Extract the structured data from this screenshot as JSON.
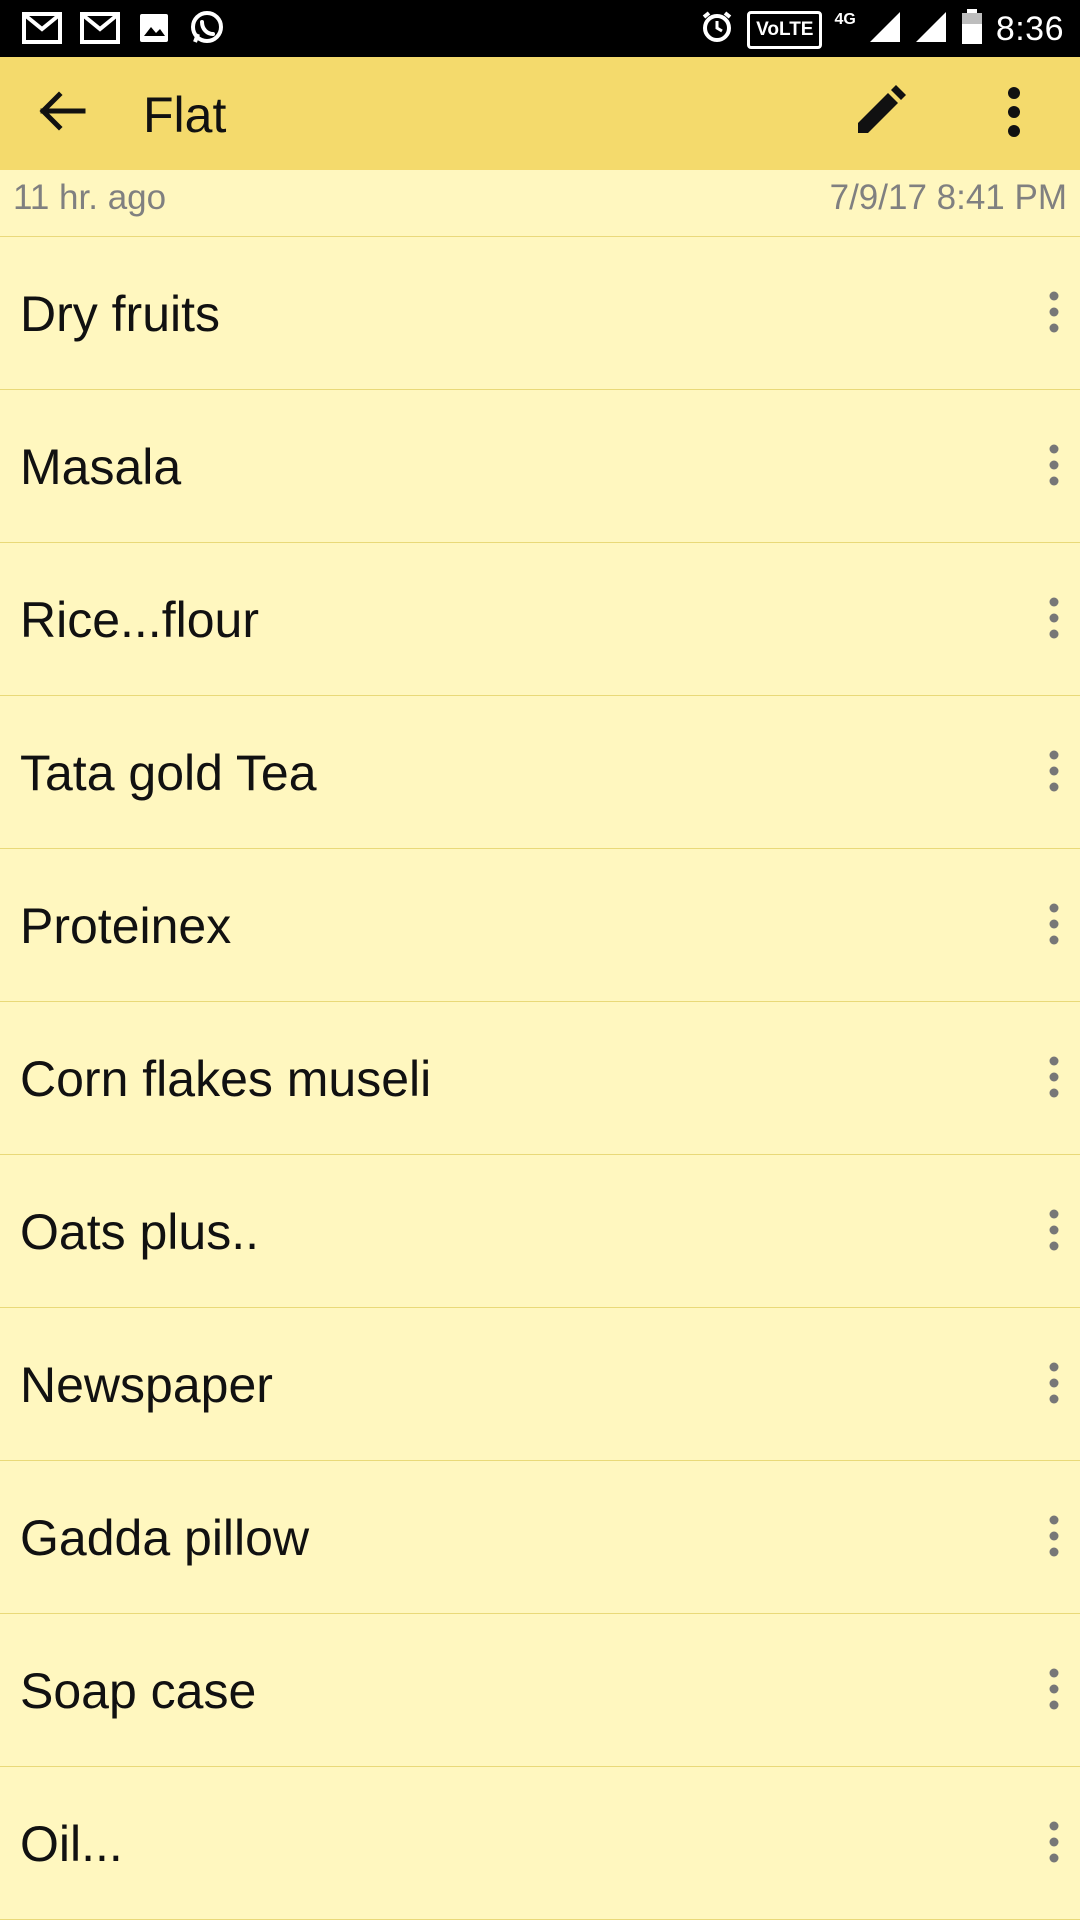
{
  "status_bar": {
    "time": "8:36",
    "volte_label": "VoLTE",
    "network_label": "4G",
    "left_icons": [
      "gmail-icon",
      "gmail-icon",
      "image-icon",
      "whatsapp-icon"
    ],
    "right_icons": [
      "alarm-icon",
      "volte-icon",
      "signal-icon",
      "signal-icon",
      "battery-icon"
    ]
  },
  "app_bar": {
    "title": "Flat",
    "back_icon": "arrow-back-icon",
    "edit_icon": "pencil-icon",
    "more_icon": "more-vert-icon",
    "background": "#f4da6c"
  },
  "meta": {
    "relative_time": "11 hr. ago",
    "date_time": "7/9/17 8:41 PM"
  },
  "items": [
    {
      "label": "Dry fruits"
    },
    {
      "label": "Masala"
    },
    {
      "label": "Rice...flour"
    },
    {
      "label": "Tata gold Tea"
    },
    {
      "label": "Proteinex"
    },
    {
      "label": "Corn flakes museli"
    },
    {
      "label": "Oats plus.."
    },
    {
      "label": "Newspaper"
    },
    {
      "label": "Gadda pillow"
    },
    {
      "label": "Soap case"
    },
    {
      "label": "Oil..."
    }
  ],
  "colors": {
    "list_background": "#fff7bf",
    "divider": "#e9d978"
  }
}
